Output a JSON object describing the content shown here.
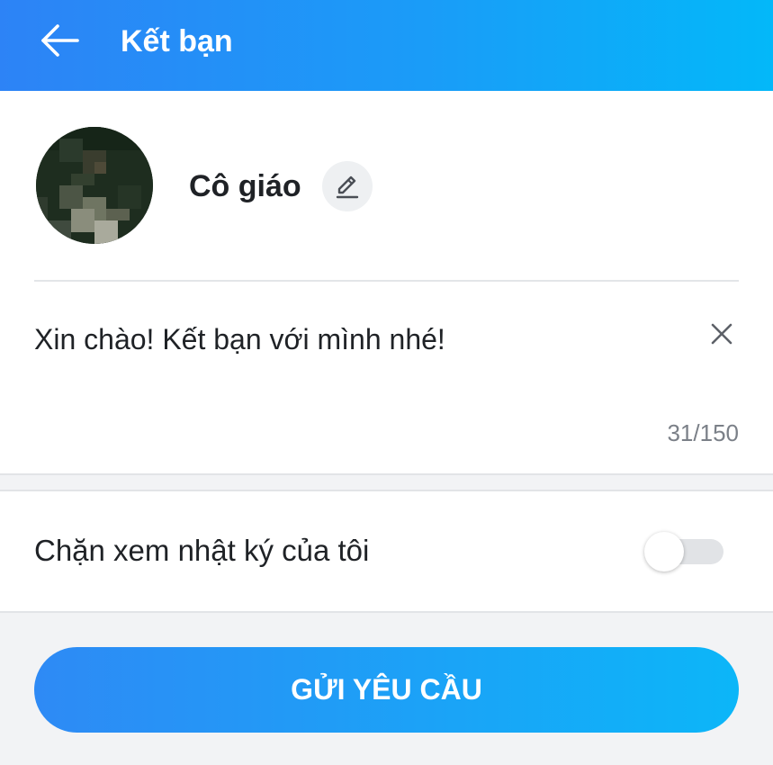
{
  "header": {
    "title": "Kết bạn",
    "back_icon": "arrow-left-icon"
  },
  "profile": {
    "name": "Cô giáo",
    "edit_icon": "pencil-icon"
  },
  "message": {
    "value": "Xin chào! Kết bạn với mình nhé!",
    "counter": "31/150",
    "clear_icon": "close-icon"
  },
  "settings": {
    "block_diary_label": "Chặn xem nhật ký của tôi",
    "block_diary_enabled": false
  },
  "actions": {
    "send_label": "GỬI YÊU CẦU"
  },
  "colors": {
    "header_gradient_start": "#2d83f6",
    "header_gradient_end": "#03b8f9",
    "button_gradient_start": "#2e8af5",
    "button_gradient_end": "#0cb6f8",
    "page_background": "#f2f3f5"
  }
}
